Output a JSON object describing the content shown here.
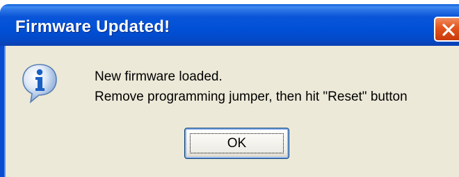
{
  "dialog": {
    "title": "Firmware Updated!",
    "icon": "information-icon",
    "message_line1": "New firmware loaded.",
    "message_line2": "Remove programming jumper, then hit \"Reset\" button",
    "ok_label": "OK",
    "close_icon": "close-x-icon"
  },
  "colors": {
    "titlebar": "#0050d6",
    "close_button": "#e2541c",
    "client_background": "#ece9d8",
    "text": "#000000"
  }
}
